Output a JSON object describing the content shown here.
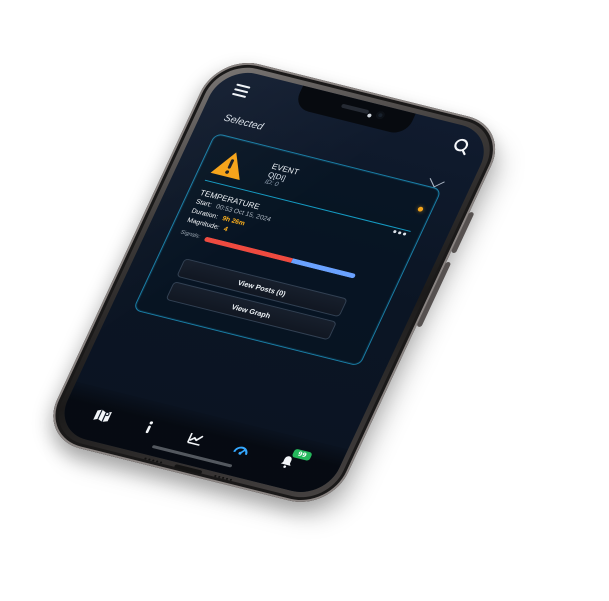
{
  "screen": {
    "section_title": "Selected",
    "event_card": {
      "event_type": "EVENT",
      "event_name": "Q[DI]",
      "event_id": "ID: 0",
      "metric_title": "TEMPERATURE",
      "start_label": "Start:",
      "start_value": "00:53 Oct 15, 2024",
      "duration_label": "Duration:",
      "duration_value": "9h 26m",
      "magnitude_label": "Magnitude:",
      "magnitude_value": "4",
      "signals_label": "Signals:",
      "signals": {
        "red_fraction": 0.58,
        "blue_fraction": 0.42
      },
      "view_posts_label": "View Posts (0)",
      "view_graph_label": "View Graph"
    },
    "bottom_nav": {
      "badge_count": "99"
    }
  },
  "icons": {
    "menu": "menu-icon",
    "search": "search-icon",
    "chevron": "chevron-down-icon",
    "warning": "warning-icon",
    "more": "more-icon",
    "map": "map-icon",
    "info": "info-icon",
    "chart": "chart-icon",
    "speed": "speedometer-icon",
    "bell": "bell-icon"
  },
  "colors": {
    "accent_blue": "#1a7ea6",
    "warning_orange": "#f6a318",
    "signal_red": "#ee4a3f",
    "signal_blue": "#6aa2ff",
    "badge_green": "#26b85c"
  }
}
